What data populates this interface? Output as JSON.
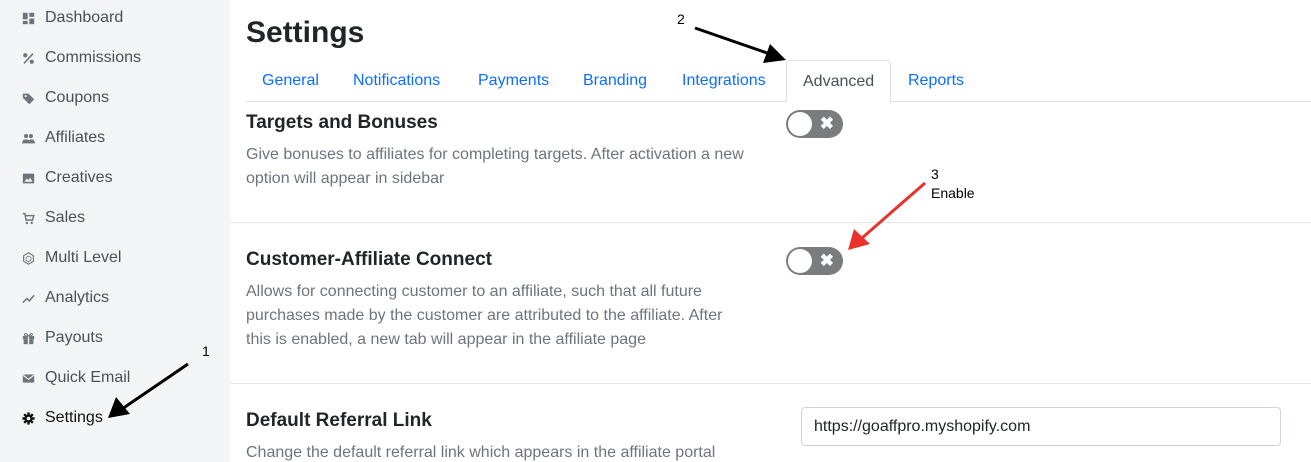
{
  "sidebar": {
    "items": [
      {
        "label": "Dashboard",
        "icon": "dashboard-icon"
      },
      {
        "label": "Commissions",
        "icon": "percent-icon"
      },
      {
        "label": "Coupons",
        "icon": "tag-icon"
      },
      {
        "label": "Affiliates",
        "icon": "people-icon"
      },
      {
        "label": "Creatives",
        "icon": "image-icon"
      },
      {
        "label": "Sales",
        "icon": "cart-icon"
      },
      {
        "label": "Multi Level",
        "icon": "hexagon-icon"
      },
      {
        "label": "Analytics",
        "icon": "trend-icon"
      },
      {
        "label": "Payouts",
        "icon": "gift-icon"
      },
      {
        "label": "Quick Email",
        "icon": "mail-icon"
      },
      {
        "label": "Settings",
        "icon": "gear-icon"
      }
    ],
    "active": "Settings"
  },
  "page": {
    "title": "Settings"
  },
  "tabs": {
    "items": [
      "General",
      "Notifications",
      "Payments",
      "Branding",
      "Integrations",
      "Advanced",
      "Reports"
    ],
    "active": "Advanced"
  },
  "sections": [
    {
      "title": "Targets and Bonuses",
      "description": "Give bonuses to affiliates for completing targets. After activation a new option will appear in sidebar",
      "toggle_state": "off",
      "toggle_glyph": "✖"
    },
    {
      "title": "Customer-Affiliate Connect",
      "description": "Allows for connecting customer to an affiliate, such that all future purchases made by the customer are attributed to the affiliate. After this is enabled, a new tab will appear in the affiliate page",
      "toggle_state": "off",
      "toggle_glyph": "✖"
    },
    {
      "title": "Default Referral Link",
      "description": "Change the default referral link which appears in the affiliate portal",
      "input_value": "https://goaffpro.myshopify.com"
    }
  ],
  "annotations": [
    {
      "number": "1",
      "text": "",
      "color": "#000000"
    },
    {
      "number": "2",
      "text": "",
      "color": "#000000"
    },
    {
      "number": "3",
      "text": "Enable",
      "color": "#e8322b"
    }
  ],
  "colors": {
    "accent": "#0d6efd",
    "sidebar_bg": "#f4f5f7",
    "toggle_off": "#7a7d80"
  }
}
